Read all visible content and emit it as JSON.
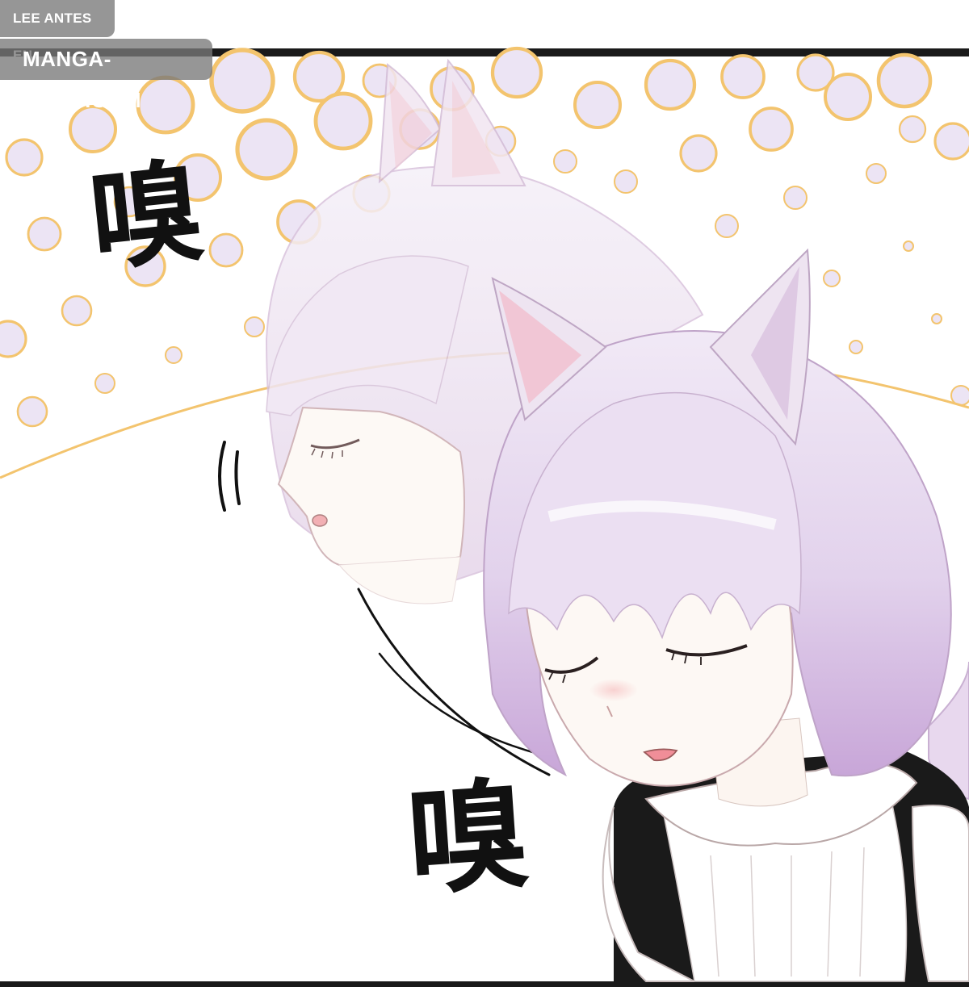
{
  "watermark": {
    "line1": "LEE ANTES EN:",
    "line2": "MANGA-CRAB.COM",
    "background_color": "#787878",
    "text_color": "#ffffff"
  },
  "sound_effects": [
    {
      "text": "嗅"
    },
    {
      "text": "嗅"
    }
  ],
  "palette": {
    "panel_border": "#1a1a1a",
    "bubble_ring": "#f3c46e",
    "bubble_fill": "#ece4f4",
    "hair": "#e3d4ec",
    "hair_shadow": "#c7a6d6",
    "ear_inner": "#f2bccb",
    "skin": "#fdf7f2",
    "dress": "#1a1a1a",
    "collar": "#ffffff"
  }
}
